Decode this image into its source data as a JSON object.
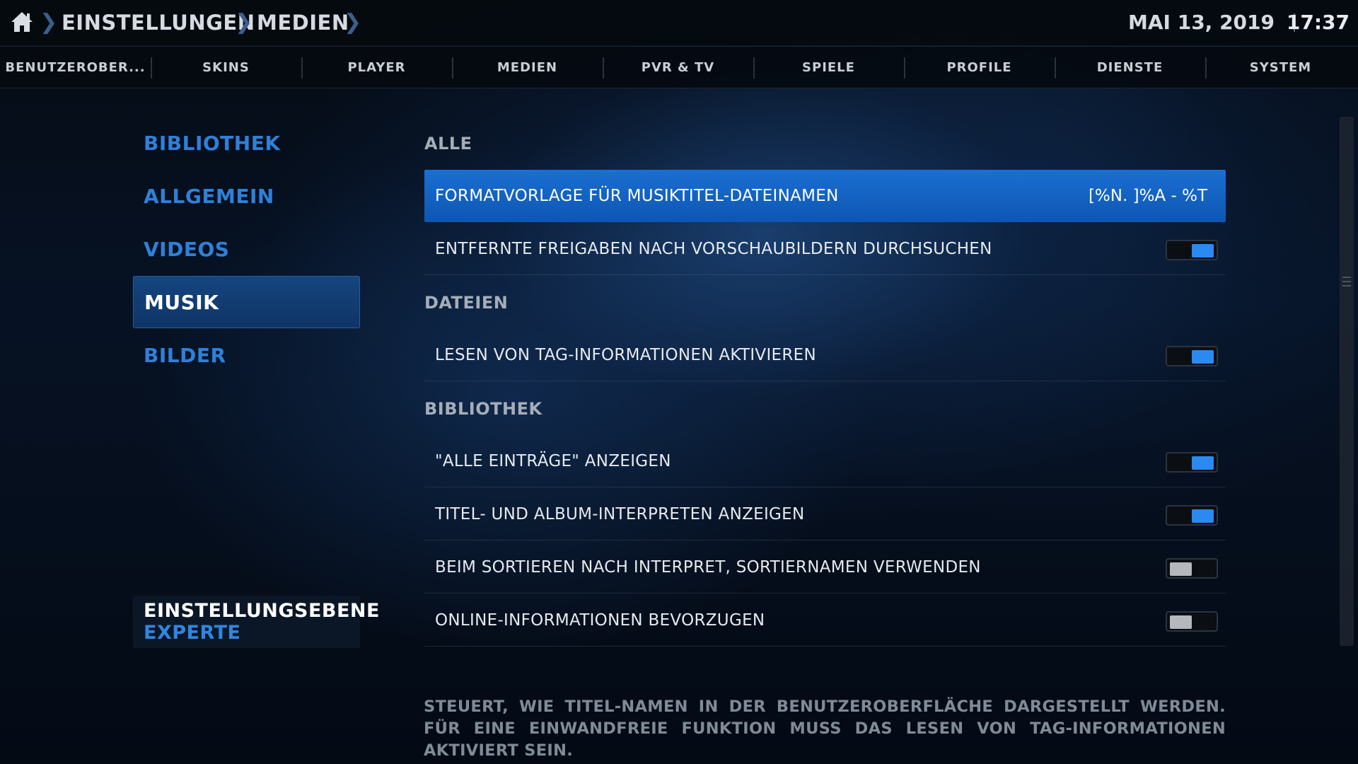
{
  "header": {
    "breadcrumbs": [
      "Einstellungen",
      "Medien"
    ],
    "date": "Mai 13, 2019",
    "time": "17:37"
  },
  "tabs": [
    "Benutzerober...",
    "Skins",
    "Player",
    "Medien",
    "PVR & TV",
    "Spiele",
    "Profile",
    "Dienste",
    "System"
  ],
  "sidebar": {
    "items": [
      "Bibliothek",
      "Allgemein",
      "Videos",
      "Musik",
      "Bilder"
    ],
    "active_index": 3,
    "level_title": "Einstellungsebene",
    "level_value": "Experte"
  },
  "groups": {
    "alle": "Alle",
    "dateien": "Dateien",
    "bibliothek": "Bibliothek"
  },
  "settings": [
    {
      "label": "Formatvorlage für Musiktitel-Dateinamen",
      "value": "[%N. ]%A - %T",
      "focused": true
    },
    {
      "label": "Entfernte Freigaben nach Vorschaubildern durchsuchen",
      "toggle": true
    },
    {
      "label": "Lesen von Tag-Informationen aktivieren",
      "toggle": true
    },
    {
      "label": "\"Alle Einträge\" anzeigen",
      "toggle": true
    },
    {
      "label": "Titel- und Album-Interpreten anzeigen",
      "toggle": true
    },
    {
      "label": "Beim Sortieren nach Interpret, Sortiernamen verwenden",
      "toggle": false
    },
    {
      "label": "Online-Informationen bevorzugen",
      "toggle": false
    }
  ],
  "description": "Steuert, wie Titel-Namen in der Benutzeroberfläche dargestellt werden. Für eine einwandfreie Funktion muss das Lesen von Tag-Informationen aktiviert sein.",
  "colors": {
    "accent": "#1a6fd2",
    "toggle_on": "#2a8af2",
    "toggle_off": "#b5b9bd",
    "side_text": "#2f80d8"
  }
}
